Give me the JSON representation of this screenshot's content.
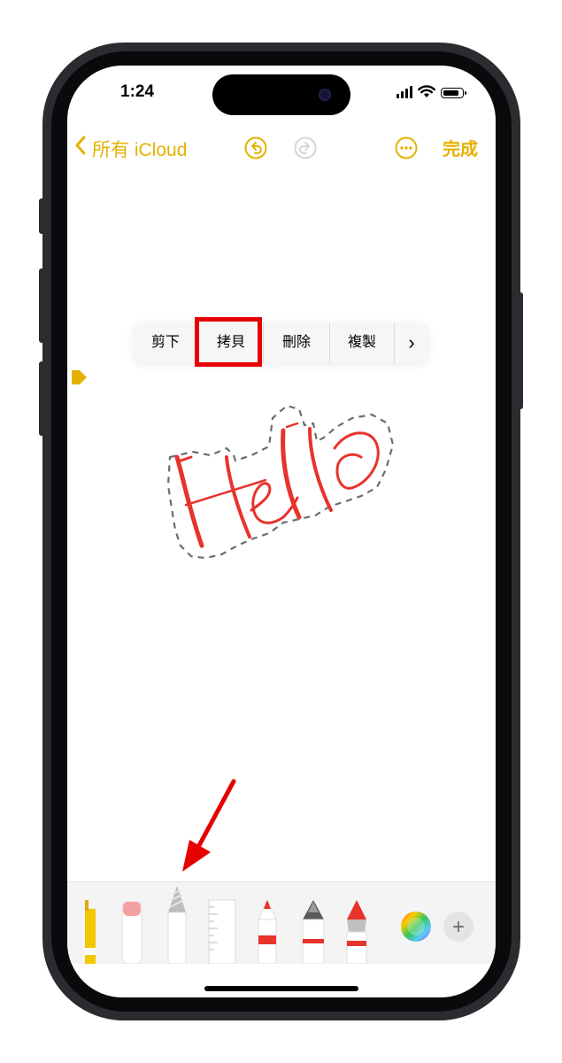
{
  "status_bar": {
    "time": "1:24"
  },
  "nav": {
    "back_label": "所有 iCloud",
    "done_label": "完成"
  },
  "ghost_text": "",
  "context_menu": {
    "items": [
      {
        "label": "剪下"
      },
      {
        "label": "拷貝"
      },
      {
        "label": "刪除"
      },
      {
        "label": "複製"
      },
      {
        "label": "›"
      }
    ]
  },
  "handwriting": {
    "text": "Hello",
    "color": "#e8322c"
  },
  "toolbar": {
    "tools": [
      "highlighter-tool",
      "eraser-tool",
      "pencil-tool",
      "ruler-tool",
      "marker-tool",
      "fountain-pen-tool",
      "crayon-tool"
    ],
    "add_label": "+"
  },
  "colors": {
    "accent": "#e5b100",
    "annotation": "#e60000"
  }
}
